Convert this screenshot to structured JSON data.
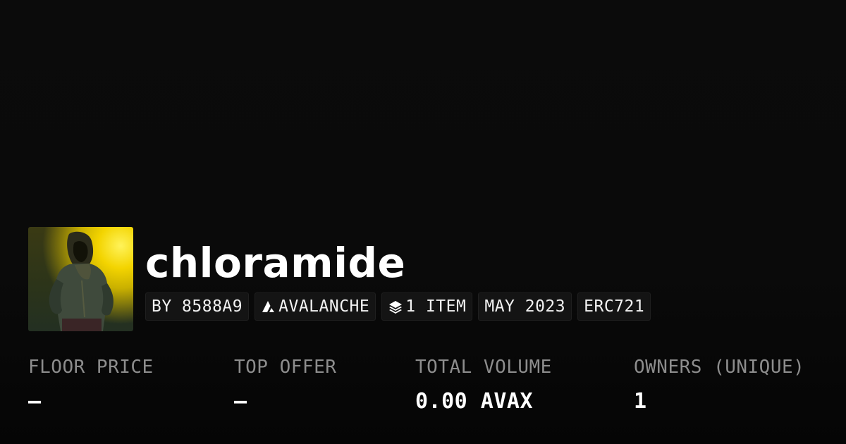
{
  "collection": {
    "name": "chloramide",
    "avatar_icon": "hooded-figure-image"
  },
  "chips": [
    {
      "label": "BY 8588A9"
    },
    {
      "label": "AVALANCHE",
      "icon": "avalanche-icon"
    },
    {
      "label": "1 ITEM",
      "icon": "layers-icon"
    },
    {
      "label": "MAY 2023"
    },
    {
      "label": "ERC721"
    }
  ],
  "stats": {
    "floor_price": {
      "label": "FLOOR PRICE",
      "value": "–"
    },
    "top_offer": {
      "label": "TOP OFFER",
      "value": "–"
    },
    "total_volume": {
      "label": "TOTAL VOLUME",
      "value": "0.00 AVAX"
    },
    "owners": {
      "label": "OWNERS (UNIQUE)",
      "value": "1"
    }
  },
  "colors": {
    "background": "#0a0a0a",
    "chip_background": "#141414",
    "label": "#8d8d8d",
    "text": "#ffffff",
    "avatar_accent": "#f3d400"
  }
}
